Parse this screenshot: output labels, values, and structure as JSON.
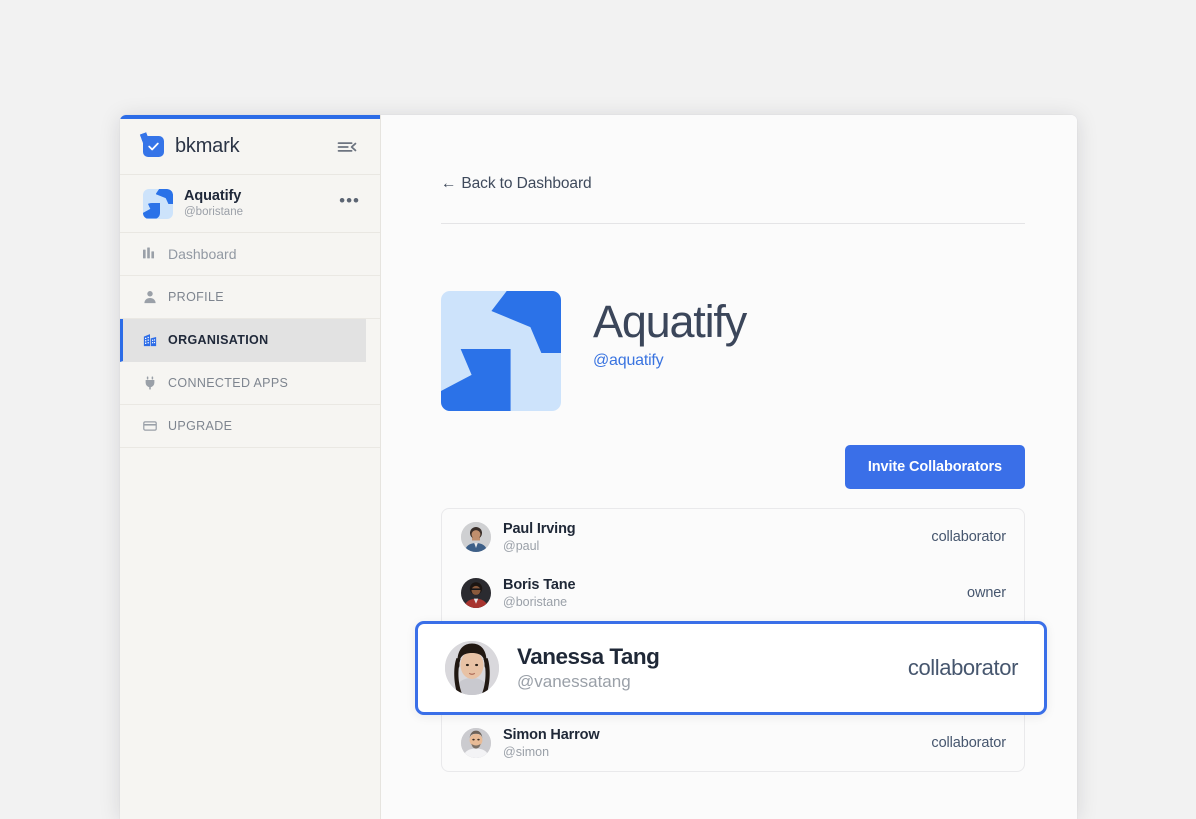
{
  "brand": {
    "name": "bkmark",
    "logo_icon": "check-bookmark-icon",
    "collapse_icon": "collapse-sidebar-icon",
    "accent_color": "#2c6ce7"
  },
  "sidebar": {
    "org": {
      "name": "Aquatify",
      "handle": "@boristane",
      "more_label": "•••",
      "avatar_icon": "aquatify-logo-icon"
    },
    "items": [
      {
        "label": "Dashboard",
        "icon": "dashboard-grid-icon",
        "active": false
      },
      {
        "label": "PROFILE",
        "icon": "person-icon",
        "active": false
      },
      {
        "label": "ORGANISATION",
        "icon": "building-icon",
        "active": true
      },
      {
        "label": "CONNECTED APPS",
        "icon": "plug-icon",
        "active": false
      },
      {
        "label": "UPGRADE",
        "icon": "credit-card-icon",
        "active": false
      }
    ]
  },
  "main": {
    "back_link": {
      "arrow": "←",
      "label": "Back to Dashboard"
    },
    "org_header": {
      "title": "Aquatify",
      "handle": "@aquatify",
      "avatar_icon": "aquatify-logo-icon"
    },
    "invite_button": "Invite Collaborators",
    "collaborators": [
      {
        "name": "Paul Irving",
        "handle": "@paul",
        "role": "collaborator",
        "highlight": false
      },
      {
        "name": "Boris Tane",
        "handle": "@boristane",
        "role": "owner",
        "highlight": false
      },
      {
        "name": "Vanessa Tang",
        "handle": "@vanessatang",
        "role": "collaborator",
        "highlight": true
      },
      {
        "name": "Simon Harrow",
        "handle": "@simon",
        "role": "collaborator",
        "highlight": false
      }
    ]
  },
  "colors": {
    "accent": "#3a6fe8",
    "sidebar_bg": "#f6f5f2",
    "active_item_bg": "#e2e2e2",
    "page_bg": "#f2f2f2",
    "logo_light": "#cde3fb",
    "logo_dark": "#2b72e8"
  }
}
